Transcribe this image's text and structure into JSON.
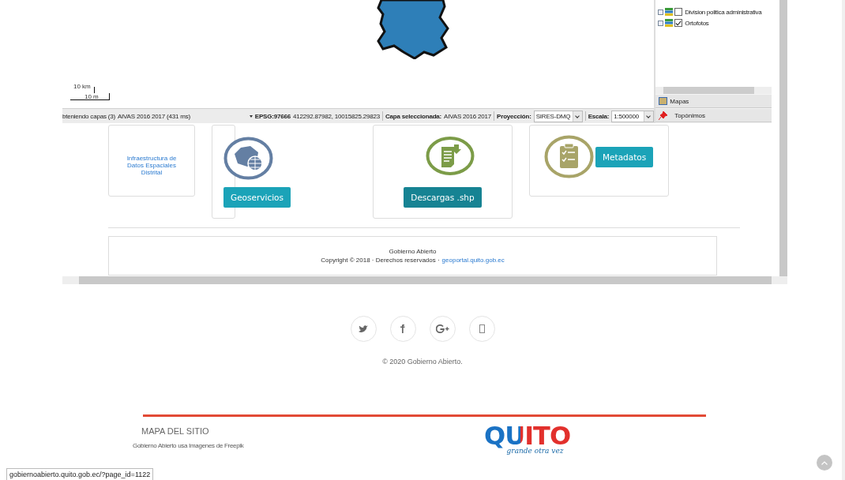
{
  "map": {
    "scale_top": "10 km",
    "scale_bottom": "10 m"
  },
  "status_bar": {
    "loading": "bteniendo capas (3)",
    "timing": "AIVAS 2016 2017 (431 ms)",
    "epsg": "EPSG:97666",
    "coordinates": "412292.87982, 10015825.29823",
    "selected_label": "Capa seleccionada:",
    "selected_value": "AIVAS 2016 2017",
    "projection_label": "Proyección:",
    "projection": "SIRES-DMQ",
    "scale_label": "Escala:",
    "scale": "1:500000"
  },
  "layers": [
    {
      "label": "Division politica administrativa",
      "checked": false
    },
    {
      "label": "Ortofotos",
      "checked": true
    }
  ],
  "panel_tabs": [
    {
      "kind": "map",
      "label": "Mapas"
    },
    {
      "kind": "pin",
      "label": "Topónimos"
    }
  ],
  "cards": [
    {
      "kind": "text",
      "text": "Infraestructura de Datos Espaciales Distrital"
    },
    {
      "kind": "geo",
      "button": "Geoservicios"
    },
    {
      "kind": "download",
      "button": "Descargas .shp"
    },
    {
      "kind": "metadata",
      "button": "Metadatos"
    }
  ],
  "footer_box": {
    "title": "Gobierno Abierto",
    "copyright": "Copyright © 2018 · Derechos reservados ·",
    "link": "geoportal.quito.gob.ec"
  },
  "social": [
    {
      "kind": "twitter"
    },
    {
      "kind": "facebook"
    },
    {
      "kind": "google-plus"
    },
    {
      "kind": "missing"
    }
  ],
  "copyright": "© 2020 Gobierno Abierto.",
  "site_map": {
    "title": "MAPA DEL SITIO",
    "credit": "Gobierno Abierto usa Imagenes de Freepik"
  },
  "logo": {
    "word": "QUITO",
    "tagline": "grande otra vez"
  },
  "status_url": "gobiernoabierto.quito.gob.ec/?page_id=1122"
}
